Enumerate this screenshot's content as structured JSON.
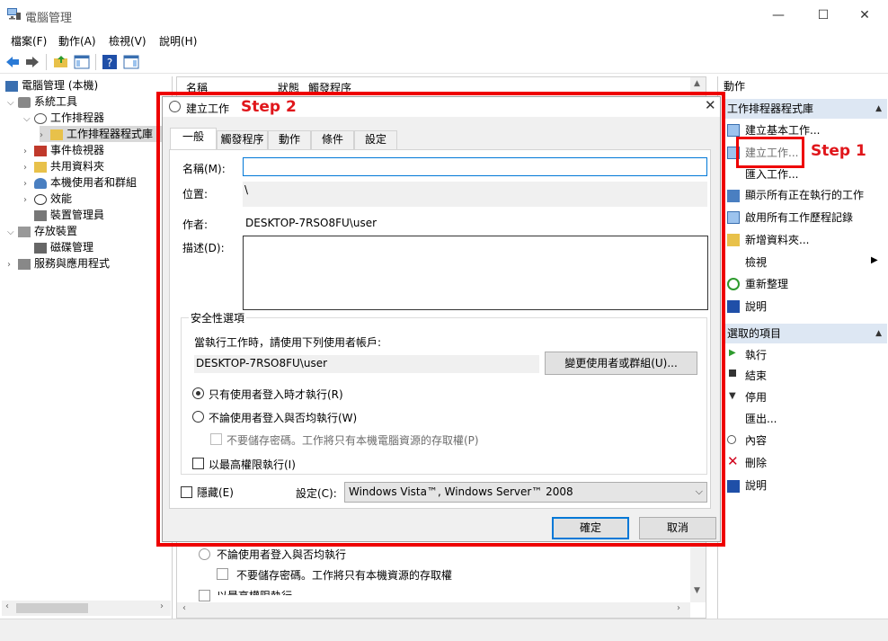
{
  "window": {
    "title": "電腦管理",
    "controls": {
      "minimize": "—",
      "maximize": "☐",
      "close": "✕"
    }
  },
  "menu": [
    "檔案(F)",
    "動作(A)",
    "檢視(V)",
    "說明(H)"
  ],
  "tree": [
    {
      "label": "電腦管理 (本機)",
      "level": 0,
      "arrow": ""
    },
    {
      "label": "系統工具",
      "level": 1,
      "arrow": "v"
    },
    {
      "label": "工作排程器",
      "level": 2,
      "arrow": "v"
    },
    {
      "label": "工作排程器程式庫",
      "level": 3,
      "arrow": ">"
    },
    {
      "label": "事件檢視器",
      "level": 2,
      "arrow": ">"
    },
    {
      "label": "共用資料夾",
      "level": 2,
      "arrow": ">"
    },
    {
      "label": "本機使用者和群組",
      "level": 2,
      "arrow": ">"
    },
    {
      "label": "效能",
      "level": 2,
      "arrow": ">"
    },
    {
      "label": "裝置管理員",
      "level": 2,
      "arrow": ""
    },
    {
      "label": "存放裝置",
      "level": 1,
      "arrow": "v"
    },
    {
      "label": "磁碟管理",
      "level": 2,
      "arrow": ""
    },
    {
      "label": "服務與應用程式",
      "level": 1,
      "arrow": ">"
    }
  ],
  "center": {
    "col_name": "名稱",
    "col_status": "狀態",
    "col_trigger": "觸發程序",
    "behind_radio": "不論使用者登入與否均執行",
    "behind_chk": "不要儲存密碼。工作將只有本機資源的存取權",
    "behind_chk2": "以最高權限執行"
  },
  "actions": {
    "header": "動作",
    "section1": "工作排程器程式庫",
    "items1": [
      "建立基本工作...",
      "建立工作...",
      "匯入工作...",
      "顯示所有正在執行的工作",
      "啟用所有工作歷程記錄",
      "新增資料夾...",
      "檢視",
      "重新整理",
      "說明"
    ],
    "section2": "選取的項目",
    "items2": [
      "執行",
      "結束",
      "停用",
      "匯出...",
      "內容",
      "刪除",
      "說明"
    ]
  },
  "annotations": {
    "step1": "Step 1",
    "step2": "Step 2"
  },
  "dialog": {
    "title": "建立工作",
    "tabs": [
      "一般",
      "觸發程序",
      "動作",
      "條件",
      "設定"
    ],
    "name_label": "名稱(M):",
    "name_value": "",
    "location_label": "位置:",
    "location_value": "\\",
    "author_label": "作者:",
    "author_value": "DESKTOP-7RSO8FU\\user",
    "desc_label": "描述(D):",
    "security_group": "安全性選項",
    "run_as_text": "當執行工作時，請使用下列使用者帳戶:",
    "user_account": "DESKTOP-7RSO8FU\\user",
    "change_user_btn": "變更使用者或群組(U)...",
    "radio1": "只有使用者登入時才執行(R)",
    "radio2": "不論使用者登入與否均執行(W)",
    "no_store_pwd": "不要儲存密碼。工作將只有本機電腦資源的存取權(P)",
    "highest_priv": "以最高權限執行(I)",
    "hidden_label": "隱藏(E)",
    "config_label": "設定(C):",
    "config_value": "Windows Vista™, Windows Server™ 2008",
    "ok": "確定",
    "cancel": "取消"
  }
}
